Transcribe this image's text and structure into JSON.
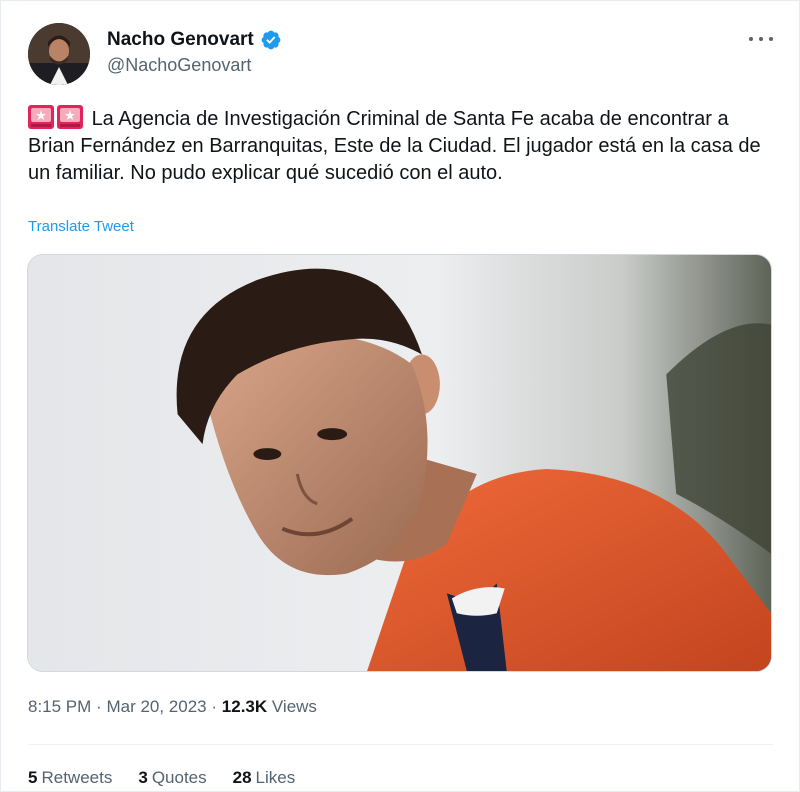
{
  "author": {
    "display_name": "Nacho Genovart",
    "handle": "@NachoGenovart",
    "verified": true
  },
  "tweet": {
    "emoji": [
      "police-light-icon",
      "police-light-icon"
    ],
    "text": "La Agencia de Investigación Criminal de Santa Fe acaba de encontrar a Brian Fernández en Barranquitas, Este de la Ciudad. El jugador está en la casa de un familiar. No pudo explicar qué sucedió con el auto.",
    "translate_label": "Translate Tweet"
  },
  "meta": {
    "time": "8:15 PM",
    "separator": "·",
    "date": "Mar 20, 2023",
    "views_count": "12.3K",
    "views_label": "Views"
  },
  "stats": [
    {
      "count": "5",
      "label": "Retweets"
    },
    {
      "count": "3",
      "label": "Quotes"
    },
    {
      "count": "28",
      "label": "Likes"
    }
  ],
  "colors": {
    "link": "#1d9bf0",
    "secondary_text": "#536471",
    "primary_text": "#0f1419",
    "jersey": "#e2582d"
  }
}
